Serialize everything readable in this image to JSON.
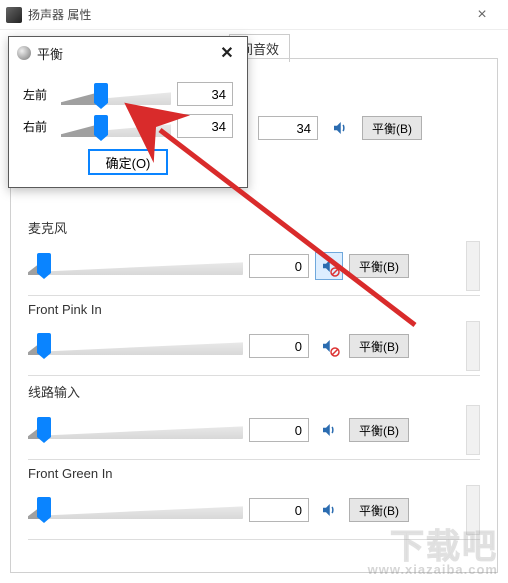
{
  "window": {
    "title": "扬声器 属性"
  },
  "tabs": {
    "sound_effects": "间音效"
  },
  "channels": [
    {
      "name": "麦克风",
      "value": 0,
      "percent": 6,
      "muted": true,
      "balance_label": "平衡(B)",
      "selected": true
    },
    {
      "name": "Front Pink In",
      "value": 0,
      "percent": 6,
      "muted": true,
      "balance_label": "平衡(B)",
      "selected": false
    },
    {
      "name": "线路输入",
      "value": 0,
      "percent": 6,
      "muted": false,
      "balance_label": "平衡(B)",
      "selected": false
    },
    {
      "name": "Front Green In",
      "value": 0,
      "percent": 6,
      "muted": false,
      "balance_label": "平衡(B)",
      "selected": false
    }
  ],
  "main_row": {
    "value": 34,
    "percent": 34,
    "balance_label": "平衡(B)"
  },
  "balance_dialog": {
    "title": "平衡",
    "rows": [
      {
        "label": "左前",
        "value": 34,
        "percent": 34
      },
      {
        "label": "右前",
        "value": 34,
        "percent": 34
      }
    ],
    "ok_label": "确定(O)"
  },
  "watermark": {
    "line1": "下载吧",
    "line2": "www.xiazaiba.com"
  }
}
